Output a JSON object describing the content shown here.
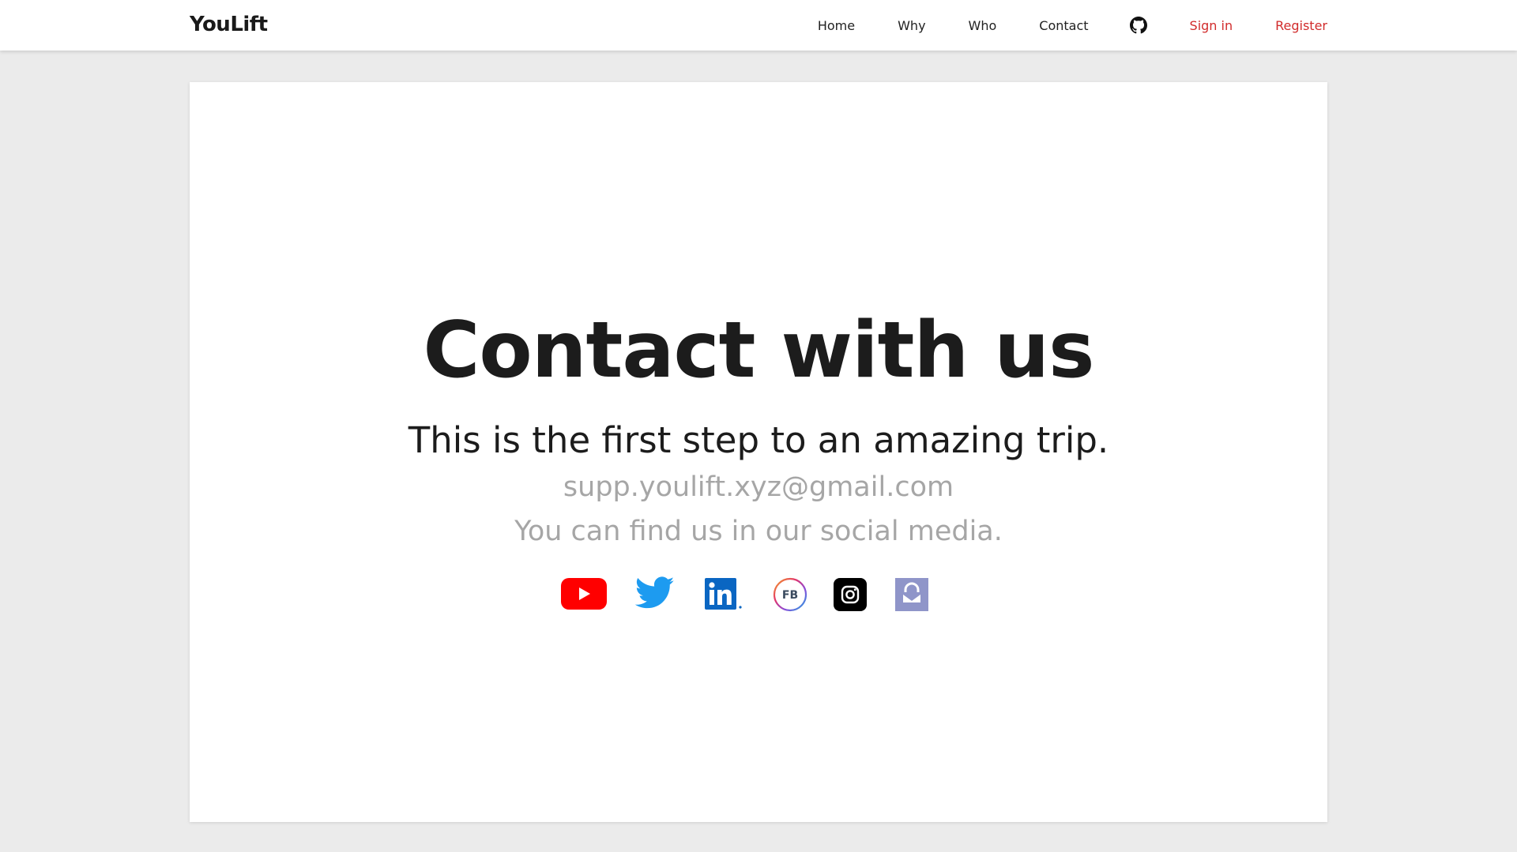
{
  "navbar": {
    "brand": "YouLift",
    "links": {
      "home": "Home",
      "why": "Why",
      "who": "Who",
      "contact": "Contact",
      "sign_in": "Sign in",
      "register": "Register"
    },
    "github_icon": "github-icon",
    "accent_color": "#d12b2b"
  },
  "main": {
    "heading": "Contact with us",
    "subheading": "This is the first step to an amazing trip.",
    "email": "supp.youlift.xyz@gmail.com",
    "social_text": "You can find us in our social media.",
    "social_icons": [
      "youtube-icon",
      "twitter-icon",
      "linkedin-icon",
      "facebook-icon",
      "instagram-icon",
      "protonmail-icon"
    ],
    "fb_icon_text": "FB"
  }
}
